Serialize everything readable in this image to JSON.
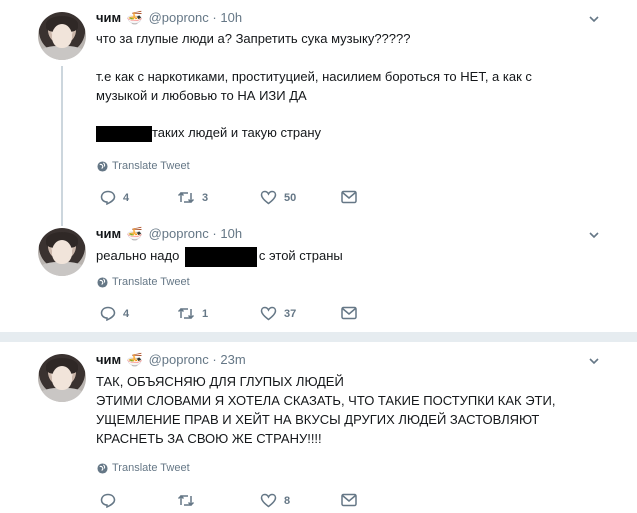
{
  "colors": {
    "text": "#14171a",
    "secondary": "#657786",
    "divider": "#e6ecf0"
  },
  "tweets": [
    {
      "name": "чим",
      "emoji": "🍜",
      "handle": "@popronc",
      "sep": "·",
      "time": "10h",
      "lines": {
        "l1": "что за глупые люди а? Запретить сука музыку?????",
        "l2": "т.е как с наркотиками, проституцией, насилием бороться то НЕТ, а как с",
        "l3": "музыкой и любовью то НА ИЗИ ДА",
        "l4": "таких людей и такую страну"
      },
      "translate": "Translate Tweet",
      "reply_count": "4",
      "retweet_count": "3",
      "like_count": "50"
    },
    {
      "name": "чим",
      "emoji": "🍜",
      "handle": "@popronc",
      "sep": "·",
      "time": "10h",
      "lines": {
        "l1a": "реально надо",
        "l1b": "с этой страны"
      },
      "translate": "Translate Tweet",
      "reply_count": "4",
      "retweet_count": "1",
      "like_count": "37"
    },
    {
      "name": "чим",
      "emoji": "🍜",
      "handle": "@popronc",
      "sep": "·",
      "time": "23m",
      "lines": {
        "l1": "ТАК, ОБЪЯСНЯЮ ДЛЯ ГЛУПЫХ ЛЮДЕЙ",
        "l2": "ЭТИМИ СЛОВАМИ Я ХОТЕЛА СКАЗАТЬ, ЧТО ТАКИЕ ПОСТУПКИ КАК ЭТИ,",
        "l3": "УЩЕМЛЕНИЕ ПРАВ И ХЕЙТ НА ВКУСЫ ДРУГИХ ЛЮДЕЙ ЗАСТОВЛЯЮТ",
        "l4": "КРАСНЕТЬ ЗА СВОЮ ЖЕ СТРАНУ!!!!"
      },
      "translate": "Translate Tweet",
      "reply_count": "",
      "retweet_count": "",
      "like_count": "8"
    }
  ],
  "icons": [
    "reply-icon",
    "retweet-icon",
    "like-icon",
    "message-icon",
    "globe-icon",
    "chevron-down-icon"
  ]
}
